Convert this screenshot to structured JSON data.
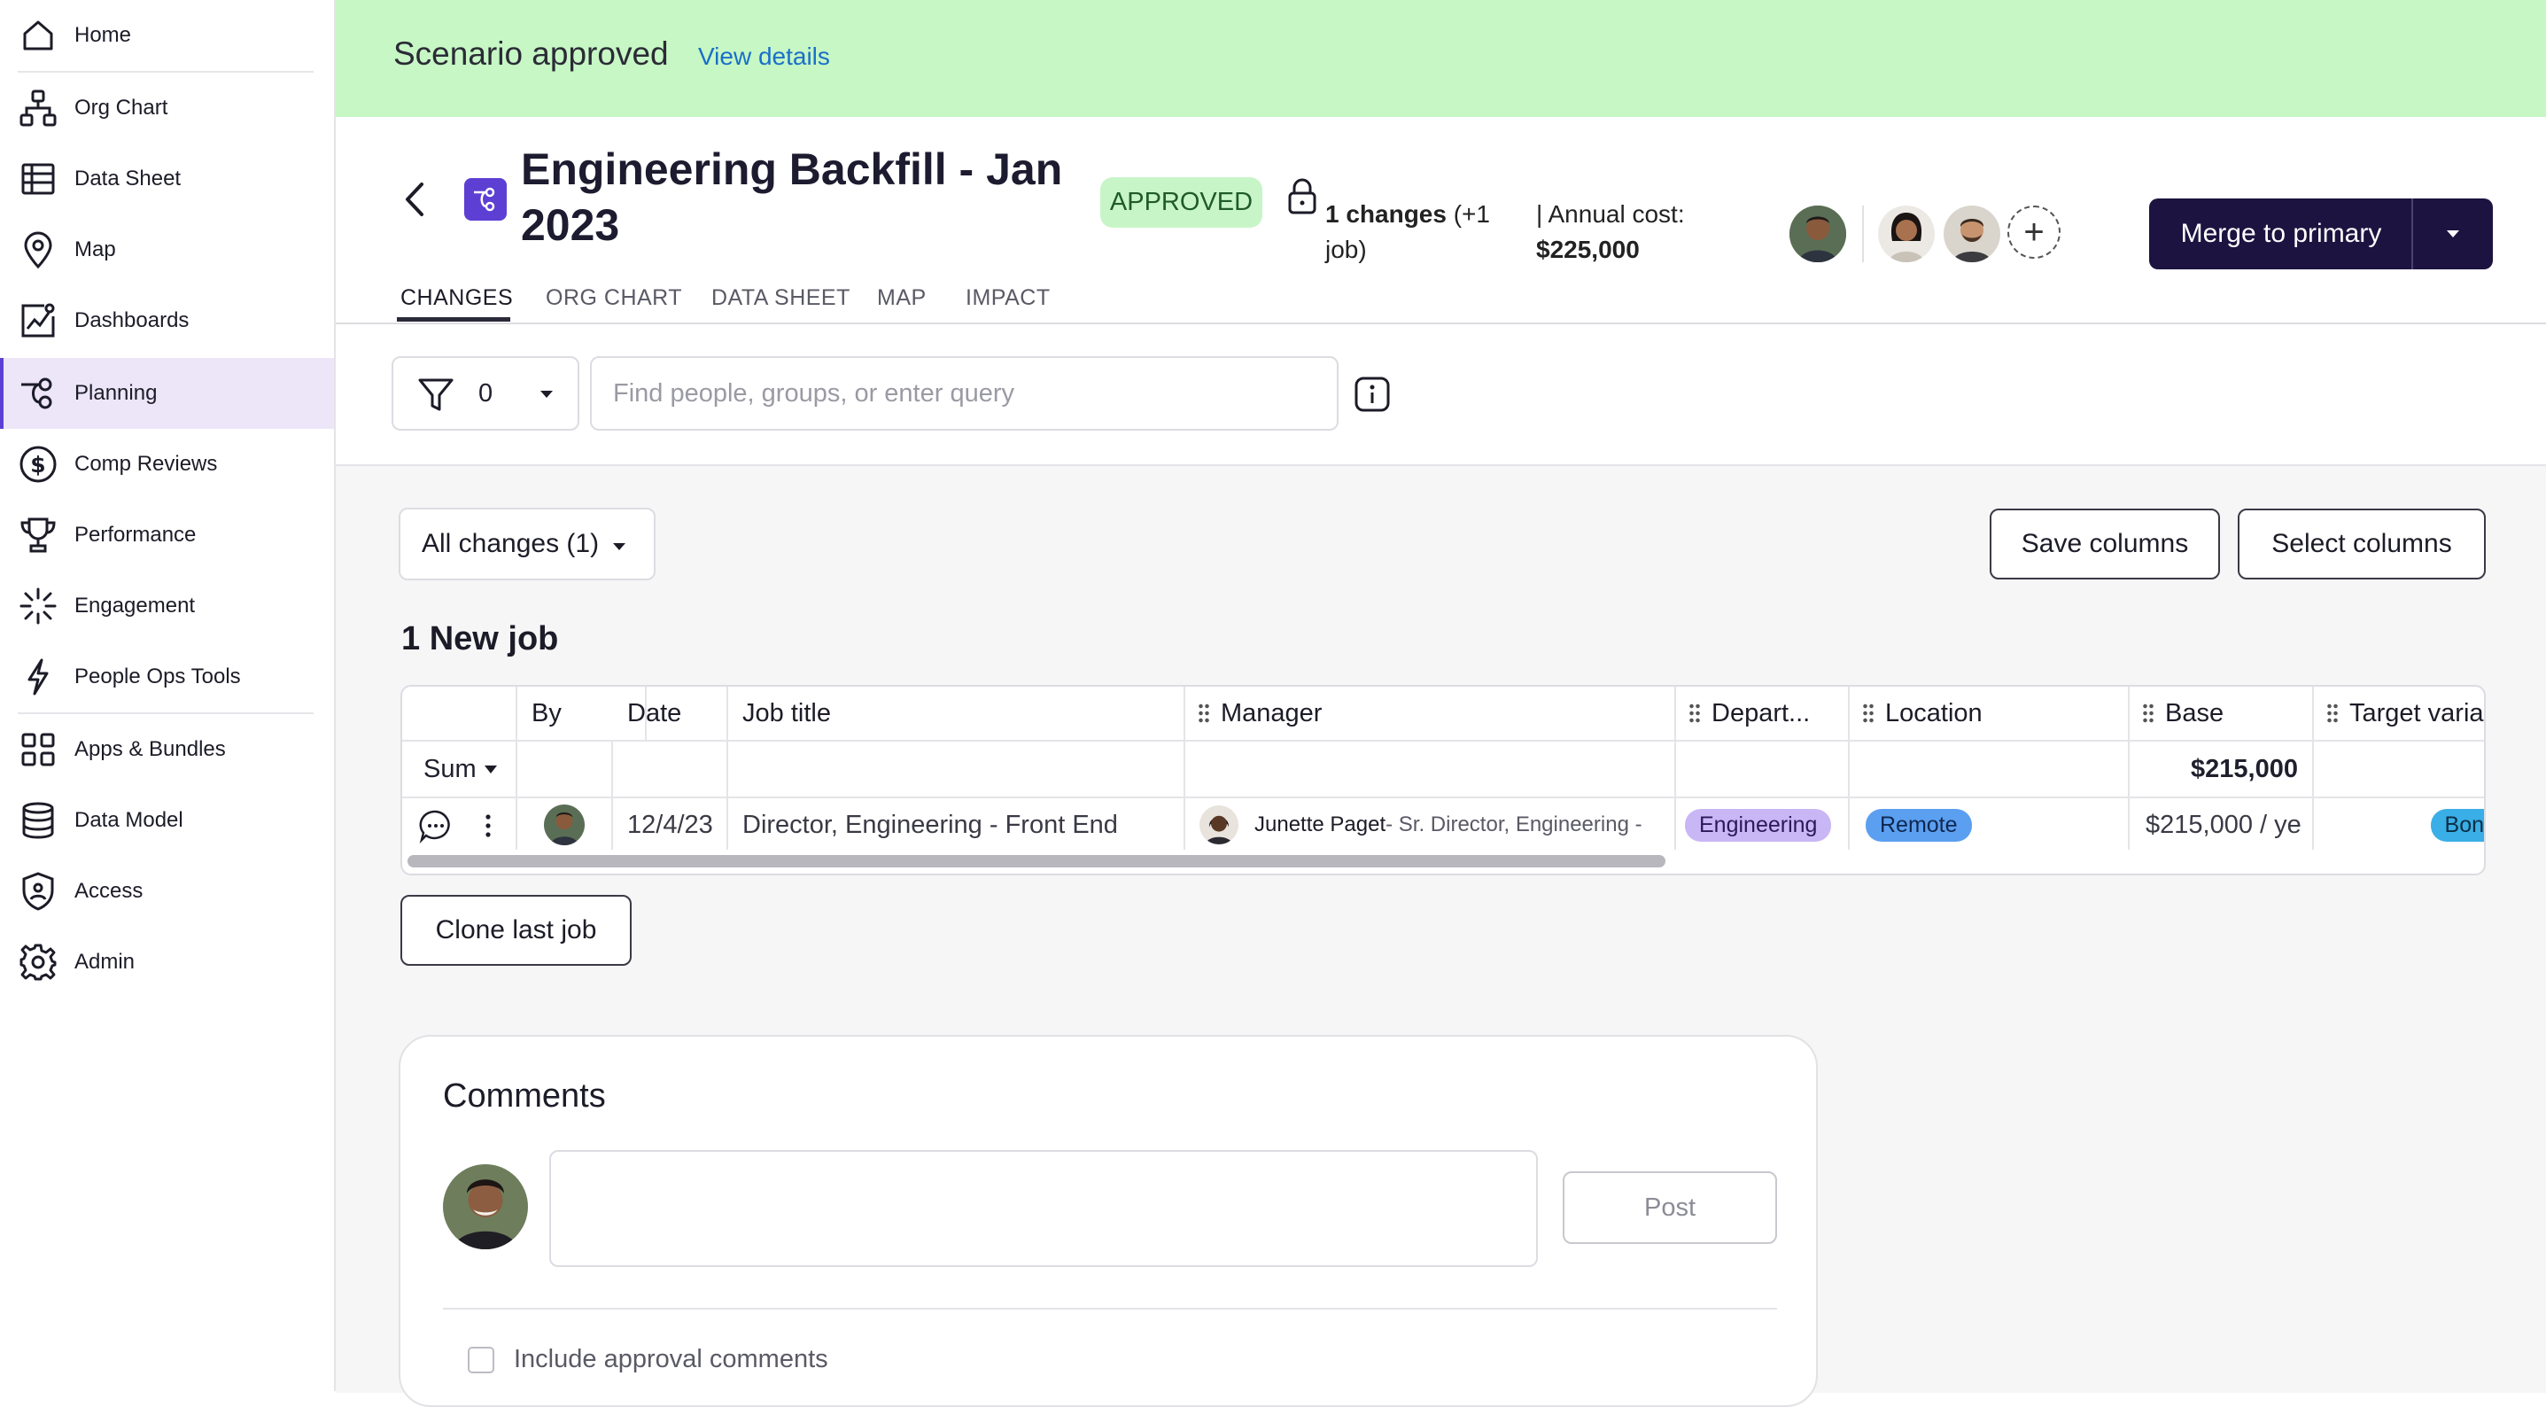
{
  "sidebar": {
    "items": [
      {
        "label": "Home",
        "icon": "home-icon"
      },
      {
        "label": "Org Chart",
        "icon": "org-chart-icon"
      },
      {
        "label": "Data Sheet",
        "icon": "data-sheet-icon"
      },
      {
        "label": "Map",
        "icon": "map-pin-icon"
      },
      {
        "label": "Dashboards",
        "icon": "dashboard-icon"
      },
      {
        "label": "Planning",
        "icon": "planning-icon"
      },
      {
        "label": "Comp Reviews",
        "icon": "dollar-icon"
      },
      {
        "label": "Performance",
        "icon": "trophy-icon"
      },
      {
        "label": "Engagement",
        "icon": "engagement-icon"
      },
      {
        "label": "People Ops Tools",
        "icon": "bolt-icon"
      },
      {
        "label": "Apps & Bundles",
        "icon": "apps-icon"
      },
      {
        "label": "Data Model",
        "icon": "database-icon"
      },
      {
        "label": "Access",
        "icon": "shield-icon"
      },
      {
        "label": "Admin",
        "icon": "gear-icon"
      }
    ],
    "active": "Planning"
  },
  "banner": {
    "message": "Scenario approved",
    "link": "View details"
  },
  "header": {
    "title": "Engineering Backfill - Jan 2023",
    "status": "APPROVED",
    "changes_count": "1 changes",
    "changes_extra": " (+1 job)",
    "cost_label": "| Annual cost:",
    "cost_value": "$225,000",
    "merge_label": "Merge to primary"
  },
  "tabs": [
    "CHANGES",
    "ORG CHART",
    "DATA SHEET",
    "MAP",
    "IMPACT"
  ],
  "filter": {
    "count": "0",
    "search_placeholder": "Find people, groups, or enter query"
  },
  "changes_select": "All changes (1)",
  "buttons": {
    "save_columns": "Save columns",
    "select_columns": "Select columns",
    "clone_last_job": "Clone last job"
  },
  "section_title": "1 New job",
  "table": {
    "columns": [
      "By",
      "Date",
      "Job title",
      "Manager",
      "Depart...",
      "Location",
      "Base",
      "Target varia"
    ],
    "summary": {
      "label": "Sum",
      "base_total": "$215,000"
    },
    "row": {
      "date": "12/4/23",
      "job_title": "Director, Engineering - Front End",
      "manager_name": "Junette Paget",
      "manager_title": " - Sr. Director, Engineering -",
      "department": "Engineering",
      "location": "Remote",
      "base": "$215,000 / ye",
      "target_variable": "Bon"
    }
  },
  "comments": {
    "title": "Comments",
    "post_label": "Post",
    "include_label": "Include approval comments"
  },
  "colors": {
    "accent": "#5d3fd3",
    "banner": "#c6f7c4",
    "merge_button": "#1c1340",
    "dept_pill": "#c9b6f5",
    "location_pill": "#5b9ff0",
    "target_pill": "#3aaee6"
  }
}
